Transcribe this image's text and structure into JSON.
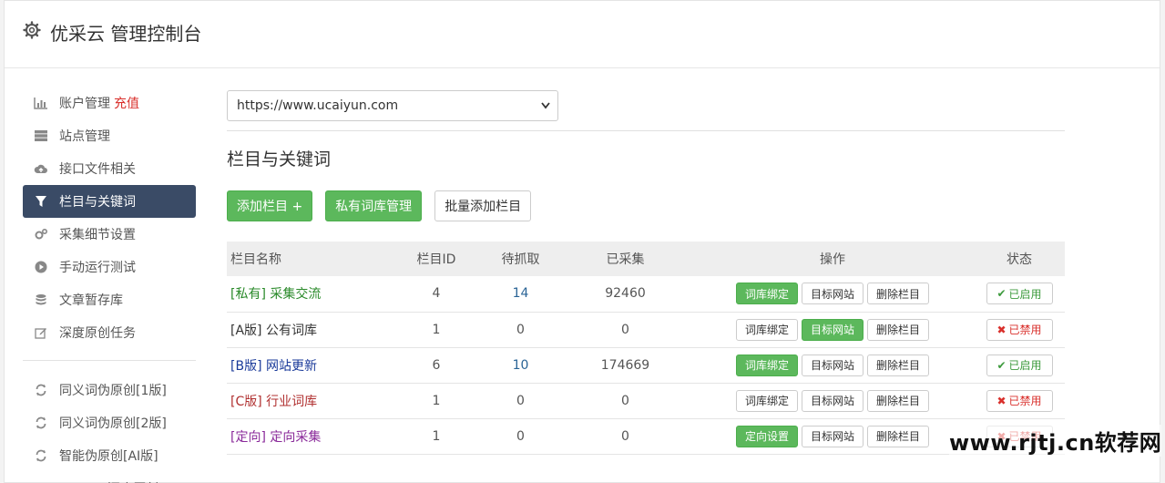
{
  "header": {
    "title": "优采云 管理控制台"
  },
  "sidebar": {
    "items": [
      {
        "label": "账户管理",
        "extra": "充值",
        "icon": "bar-chart-icon"
      },
      {
        "label": "站点管理",
        "icon": "server-icon"
      },
      {
        "label": "接口文件相关",
        "icon": "cloud-upload-icon"
      },
      {
        "label": "栏目与关键词",
        "icon": "filter-icon",
        "active": true
      },
      {
        "label": "采集细节设置",
        "icon": "cogs-icon"
      },
      {
        "label": "手动运行测试",
        "icon": "play-icon"
      },
      {
        "label": "文章暂存库",
        "icon": "database-icon"
      },
      {
        "label": "深度原创任务",
        "icon": "edit-icon"
      }
    ],
    "items2": [
      {
        "label": "同义词伪原创[1版]",
        "icon": "refresh-icon"
      },
      {
        "label": "同义词伪原创[2版]",
        "icon": "refresh-icon"
      },
      {
        "label": "智能伪原创[AI版]",
        "icon": "refresh-icon"
      },
      {
        "label": "UWriter深度原创",
        "icon": "edit-icon"
      }
    ]
  },
  "main": {
    "site_select": {
      "value": "https://www.ucaiyun.com"
    },
    "section_title": "栏目与关键词",
    "buttons": {
      "add": "添加栏目 +",
      "private": "私有词库管理",
      "batch": "批量添加栏目"
    },
    "table": {
      "headers": {
        "name": "栏目名称",
        "id": "栏目ID",
        "pending": "待抓取",
        "collected": "已采集",
        "ops": "操作",
        "status": "状态"
      },
      "rows": [
        {
          "tag": "[私有]",
          "name": "采集交流",
          "color": "#2a8a2a",
          "id": "4",
          "pending": "14",
          "collected": "92460",
          "op1": "词库绑定",
          "op1_green": true,
          "op2": "目标网站",
          "op2_green": false,
          "op3": "删除栏目",
          "status": "已启用",
          "status_on": true
        },
        {
          "tag": "[A版]",
          "name": "公有词库",
          "color": "#333333",
          "id": "1",
          "pending": "0",
          "collected": "0",
          "op1": "词库绑定",
          "op1_green": false,
          "op2": "目标网站",
          "op2_green": true,
          "op3": "删除栏目",
          "status": "已禁用",
          "status_on": false
        },
        {
          "tag": "[B版]",
          "name": "网站更新",
          "color": "#1a3a9a",
          "id": "6",
          "pending": "10",
          "collected": "174669",
          "op1": "词库绑定",
          "op1_green": true,
          "op2": "目标网站",
          "op2_green": false,
          "op3": "删除栏目",
          "status": "已启用",
          "status_on": true
        },
        {
          "tag": "[C版]",
          "name": "行业词库",
          "color": "#b03030",
          "id": "1",
          "pending": "0",
          "collected": "0",
          "op1": "词库绑定",
          "op1_green": false,
          "op2": "目标网站",
          "op2_green": false,
          "op3": "删除栏目",
          "status": "已禁用",
          "status_on": false
        },
        {
          "tag": "[定向]",
          "name": "定向采集",
          "color": "#8a2a9a",
          "id": "1",
          "pending": "0",
          "collected": "0",
          "op1": "定向设置",
          "op1_green": true,
          "op2": "目标网站",
          "op2_green": false,
          "op3": "删除栏目",
          "status": "已禁用",
          "status_on": false
        }
      ]
    }
  },
  "watermark": "www.rjtj.cn软荐网"
}
